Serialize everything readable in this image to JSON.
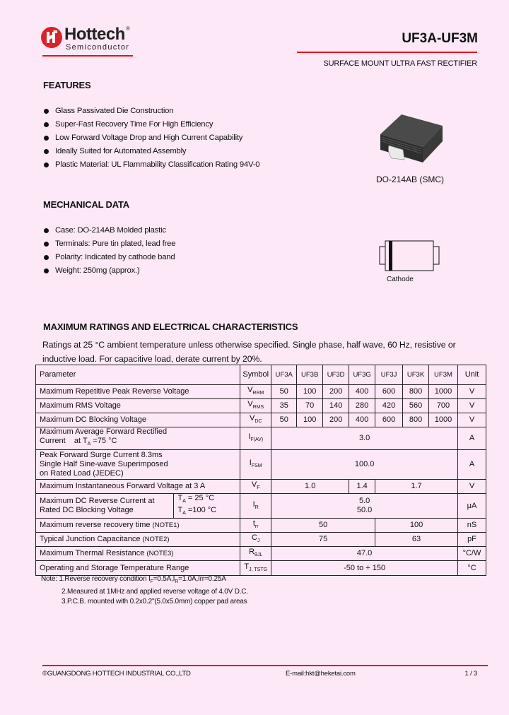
{
  "header": {
    "brand": "Hottech",
    "brand_registered": "®",
    "brand_sub": "Semiconductor",
    "part_number": "UF3A-UF3M",
    "subtitle": "SURFACE MOUNT ULTRA FAST RECTIFIER",
    "accent_color": "#e2141a"
  },
  "features": {
    "title": "FEATURES",
    "items": [
      "Glass Passivated Die Construction",
      "Super-Fast Recovery Time For High Efficiency",
      "Low Forward Voltage Drop and High Current Capability",
      "Ideally Suited for Automated Assembly",
      "Plastic Material: UL Flammability Classification Rating 94V-0"
    ]
  },
  "package": {
    "caption": "DO-214AB (SMC)",
    "cathode_label": "Cathode"
  },
  "mechanical": {
    "title": "MECHANICAL DATA",
    "items": [
      "Case: DO-214AB Molded plastic",
      "Terminals: Pure tin plated, lead free",
      "Polarity: Indicated by cathode band",
      "Weight: 250mg (approx.)"
    ]
  },
  "ratings": {
    "title": "MAXIMUM RATINGS AND ELECTRICAL CHARACTERISTICS",
    "intro": "Ratings at 25 °C ambient temperature unless otherwise specified. Single phase, half wave, 60 Hz, resistive or inductive load. For capacitive load, derate current by 20%.",
    "table": {
      "headers": {
        "parameter": "Parameter",
        "symbol": "Symbol",
        "models": [
          "UF3A",
          "UF3B",
          "UF3D",
          "UF3G",
          "UF3J",
          "UF3K",
          "UF3M"
        ],
        "unit": "Unit"
      },
      "rows": {
        "vrrm": {
          "param": "Maximum Repetitive Peak Reverse Voltage",
          "sym": "V",
          "sub": "RRM",
          "values": [
            "50",
            "100",
            "200",
            "400",
            "600",
            "800",
            "1000"
          ],
          "unit": "V"
        },
        "vrms": {
          "param": "Maximum RMS Voltage",
          "sym": "V",
          "sub": "RMS",
          "values": [
            "35",
            "70",
            "140",
            "280",
            "420",
            "560",
            "700"
          ],
          "unit": "V"
        },
        "vdc": {
          "param": "Maximum DC Blocking Voltage",
          "sym": "V",
          "sub": "DC",
          "values": [
            "50",
            "100",
            "200",
            "400",
            "600",
            "800",
            "1000"
          ],
          "unit": "V"
        },
        "ifav": {
          "param_l1": "Maximum Average Forward Rectified",
          "param_l2": "Current    at T",
          "param_l2_sub": "A",
          "param_l2_end": " =75 °C",
          "sym": "I",
          "sub": "F(AV)",
          "value": "3.0",
          "unit": "A"
        },
        "ifsm": {
          "param_l1": "Peak Forward Surge Current 8.3ms",
          "param_l2": "Single Half Sine-wave Superimposed",
          "param_l3": "on Rated Load (JEDEC)",
          "sym": "I",
          "sub": "FSM",
          "value": "100.0",
          "unit": "A"
        },
        "vf": {
          "param": "Maximum Instantaneous Forward Voltage at 3 A",
          "sym": "V",
          "sub": "F",
          "values": [
            "1.0",
            "1.4",
            "1.7"
          ],
          "unit": "V"
        },
        "ir": {
          "param_l1": "Maximum DC Reverse Current at",
          "param_l2": "Rated DC Blocking Voltage",
          "cond1": " = 25 °C",
          "cond2": " =100 °C",
          "cond_sym": "T",
          "cond_sub": "A",
          "sym": "I",
          "sub": "R",
          "values": [
            "5.0",
            "50.0"
          ],
          "unit": "μA"
        },
        "trr": {
          "param": "Maximum reverse recovery time",
          "note": "(NOTE1)",
          "sym": "t",
          "sub": "rr",
          "values": [
            "50",
            "100"
          ],
          "unit": "nS"
        },
        "cj": {
          "param": "Typical Junction Capacitance",
          "note": "(NOTE2)",
          "sym": "C",
          "sub": "J",
          "values": [
            "75",
            "63"
          ],
          "unit": "pF"
        },
        "rth": {
          "param": "Maximum Thermal Resistance",
          "note": "(NOTE3)",
          "sym": "R",
          "sub": "θJL",
          "value": "47.0",
          "unit": "°C/W"
        },
        "temp": {
          "param": "Operating and Storage Temperature Range",
          "sym": "T",
          "sub": "J, TSTG",
          "value": "-50 to + 150",
          "unit": "°C"
        }
      }
    },
    "notes": {
      "n1_prefix": "Note: 1.Reverse recovery condition I",
      "n1_sub1": "F",
      "n1_mid": "=0.5A,I",
      "n1_sub2": "R",
      "n1_end": "=1.0A,Irr=0.25A",
      "n2": "2.Measured at 1MHz and applied reverse voltage of 4.0V D.C.",
      "n3": "3.P.C.B. mounted with 0.2x0.2\"(5.0x5.0mm) copper pad areas"
    }
  },
  "footer": {
    "company": "©GUANGDONG HOTTECH INDUSTRIAL CO.,LTD",
    "email": "E-mail:hkt@heketai.com",
    "page": "1 / 3"
  }
}
